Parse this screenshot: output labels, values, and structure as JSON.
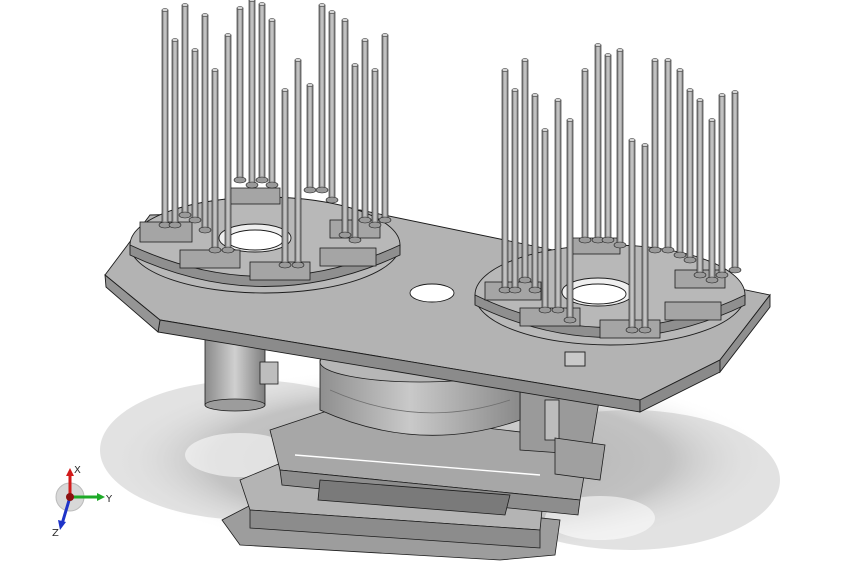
{
  "viewport": {
    "background": "#ffffff",
    "model_fill": "#a9a9a9",
    "model_face_light": "#bdbdbd",
    "model_face_dark": "#8c8c8c",
    "edge_color": "#1c1c1c",
    "shadow_color": "#666666"
  },
  "orientation_triad": {
    "x_label": "X",
    "y_label": "Y",
    "z_label": "Z",
    "x_color": "#d21a1a",
    "y_color": "#1eaa28",
    "z_color": "#1e33c8"
  }
}
